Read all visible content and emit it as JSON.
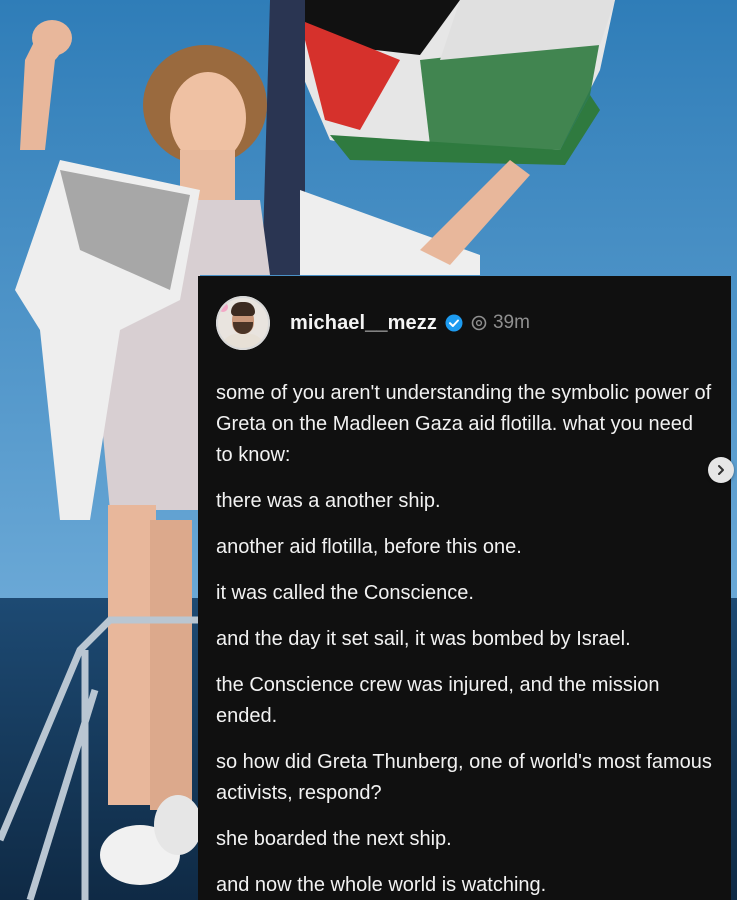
{
  "post": {
    "username": "michael__mezz",
    "verified_icon": "verified-badge-icon",
    "platform_icon": "threads-logo-icon",
    "time": "39m",
    "paragraphs": [
      "some of you aren't understanding the symbolic power of Greta on the Madleen Gaza aid flotilla. what you need to know:",
      "there was a another ship.",
      "another aid flotilla, before this one.",
      "it was called the Conscience.",
      "and the day it set sail, it was bombed by Israel.",
      "the Conscience crew was injured, and the mission ended.",
      "so how did Greta Thunberg, one of world's most famous activists, respond?",
      "she boarded the next ship.",
      "and now the whole world is watching."
    ]
  },
  "navigation": {
    "next_icon": "chevron-right-icon"
  },
  "colors": {
    "card_background": "#101010",
    "post_text": "#f2f2f2",
    "time_text": "#8f8f8f",
    "verified_blue": "#1d9bf0",
    "sky": "#3b86c2",
    "sea": "#173a5c",
    "flag_red": "#d6312c",
    "flag_green": "#2f7a3f",
    "flag_white": "#e8e8e8",
    "flag_black": "#111111"
  }
}
